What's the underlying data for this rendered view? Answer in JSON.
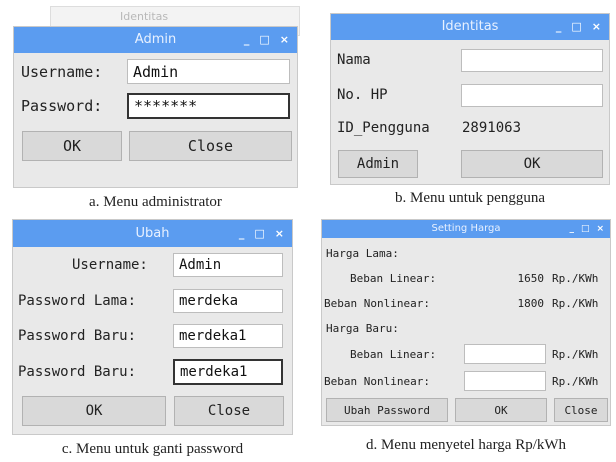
{
  "panel_a": {
    "background_title": "Identitas",
    "title": "Admin",
    "username_label": "Username:",
    "username_value": "Admin",
    "password_label": "Password:",
    "password_value": "*******",
    "ok_label": "OK",
    "close_label": "Close",
    "caption": "a. Menu administrator"
  },
  "panel_b": {
    "title": "Identitas",
    "nama_label": "Nama",
    "nama_value": "",
    "hp_label": "No. HP",
    "hp_value": "",
    "id_label": "ID_Pengguna",
    "id_value": "2891063",
    "admin_label": "Admin",
    "ok_label": "OK",
    "caption": "b. Menu untuk pengguna"
  },
  "panel_c": {
    "title": "Ubah",
    "username_label": "Username:",
    "username_value": "Admin",
    "old_pw_label": "Password Lama:",
    "old_pw_value": "merdeka",
    "new_pw_label": "Password Baru:",
    "new_pw_value": "merdeka1",
    "confirm_pw_label": "Password Baru:",
    "confirm_pw_value": "merdeka1",
    "ok_label": "OK",
    "close_label": "Close",
    "caption": "c. Menu untuk ganti password"
  },
  "panel_d": {
    "title": "Setting Harga",
    "harga_lama_label": "Harga Lama:",
    "linear_label": "Beban Linear:",
    "linear_value": "1650",
    "linear_unit": "Rp./KWh",
    "nonlinear_label": "Beban Nonlinear:",
    "nonlinear_value": "1800",
    "nonlinear_unit": "Rp./KWh",
    "harga_baru_label": "Harga Baru:",
    "new_linear_label": "Beban Linear:",
    "new_linear_value": "",
    "new_linear_unit": "Rp./KWh",
    "new_nonlinear_label": "Beban Nonlinear:",
    "new_nonlinear_value": "",
    "new_nonlinear_unit": "Rp./KWh",
    "ubah_password_label": "Ubah Password",
    "ok_label": "OK",
    "close_label": "Close",
    "caption": "d. Menu menyetel harga Rp/kWh"
  },
  "window_controls": {
    "minimize": "_",
    "maximize": "□",
    "close": "×"
  },
  "colors": {
    "titlebar": "#5b9cf0",
    "window_bg": "#e9e9e9",
    "button_bg": "#d9d9d9"
  }
}
